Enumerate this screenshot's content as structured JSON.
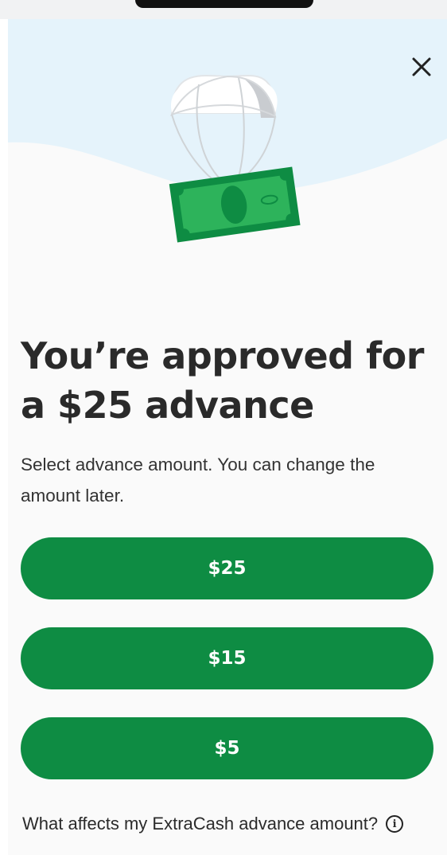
{
  "modal": {
    "close_icon": "close-icon",
    "illustration": "parachute-money-icon",
    "title": "You’re approved for a $25 advance",
    "subtitle": "Select advance amount. You can change the amount later.",
    "amount_options": [
      {
        "label": "$25"
      },
      {
        "label": "$15"
      },
      {
        "label": "$5"
      }
    ],
    "help_link": {
      "label": "What affects my ExtraCash advance amount?",
      "icon": "info-icon"
    }
  },
  "colors": {
    "accent": "#0e8c43",
    "sky": "#e5f3fb",
    "bill": "#2db35b",
    "bill_border": "#0e8c43",
    "sheet_bg": "#fafafa"
  }
}
